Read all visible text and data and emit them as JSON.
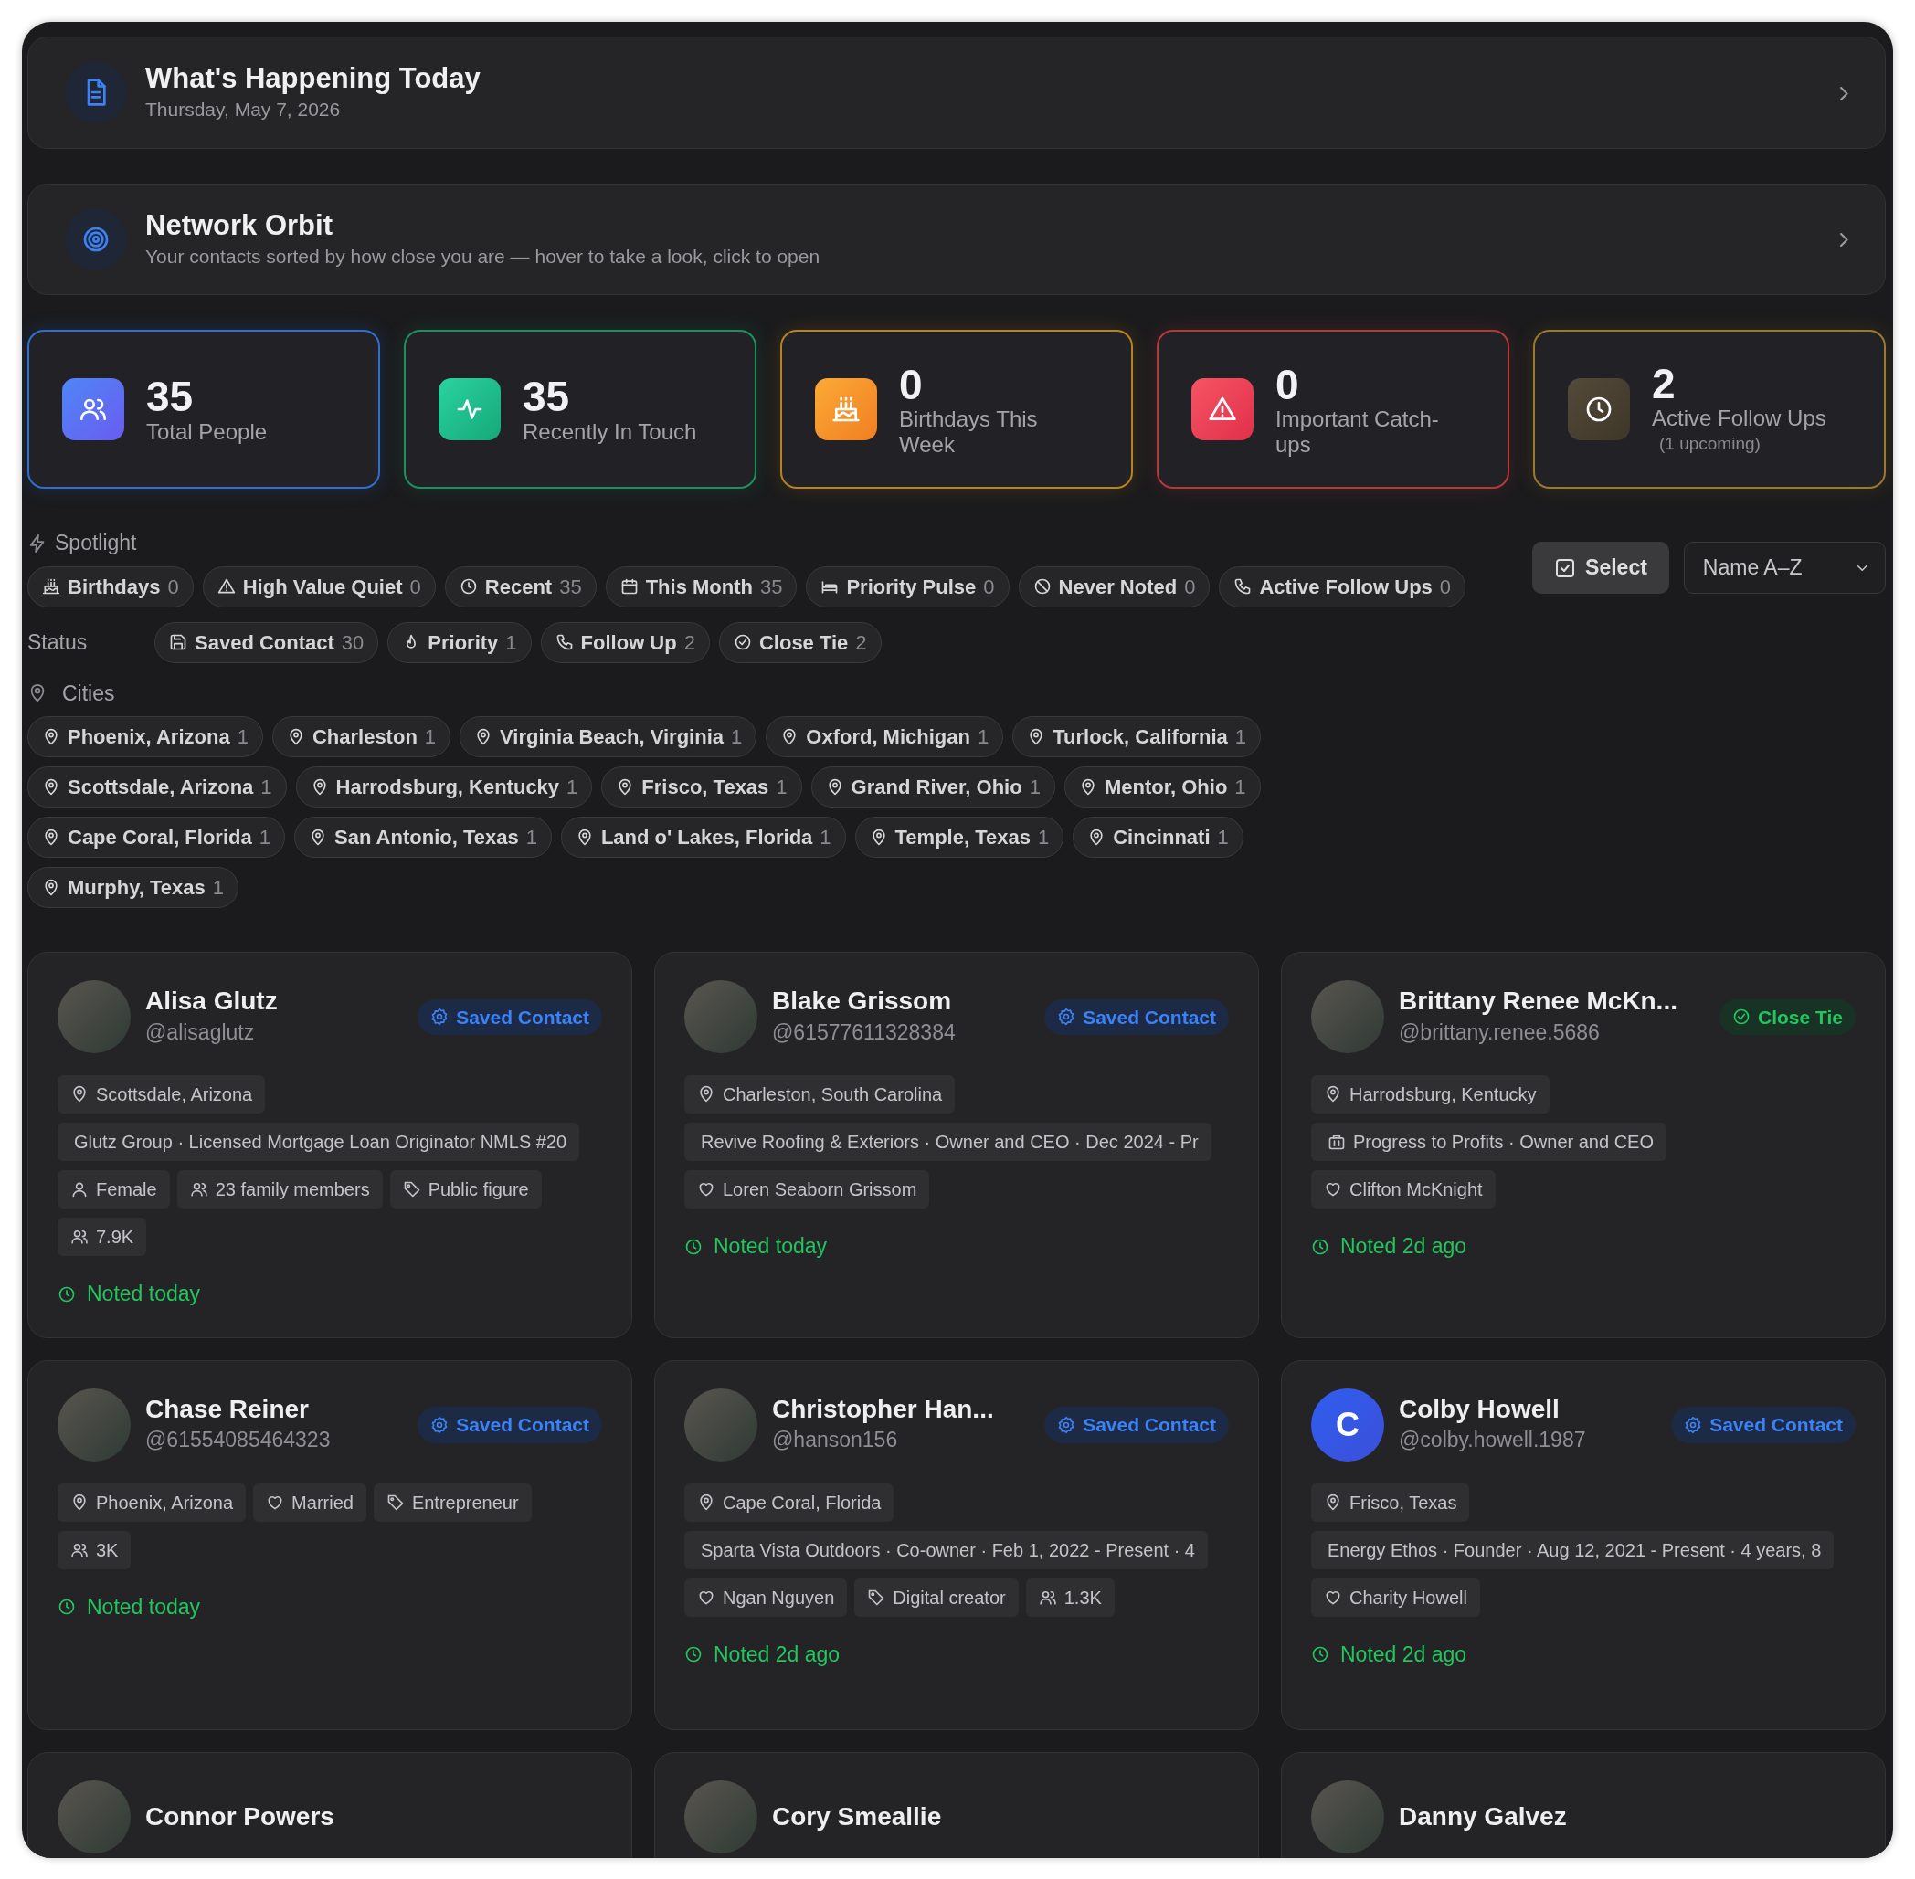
{
  "header_cards": [
    {
      "kind": "today",
      "title": "What's Happening Today",
      "subtitle": "Thursday, May 7, 2026"
    },
    {
      "kind": "orbit",
      "title": "Network Orbit",
      "subtitle": "Your contacts sorted by how close you are — hover to take a look, click to open"
    }
  ],
  "stats": [
    {
      "kind": "people",
      "value": "35",
      "label": "Total People",
      "color": "#2f6fd1"
    },
    {
      "kind": "pulse",
      "value": "35",
      "label": "Recently In Touch",
      "color": "#1f8f5f"
    },
    {
      "kind": "cake",
      "value": "0",
      "label": "Birthdays This Week",
      "color": "#b8821e"
    },
    {
      "kind": "warning",
      "value": "0",
      "label": "Important Catch-ups",
      "color": "#b33a3a"
    },
    {
      "kind": "clock",
      "value": "2",
      "label": "Active Follow Ups",
      "note": "(1 upcoming)",
      "color": "#9c7a2a"
    }
  ],
  "spotlight": {
    "label": "Spotlight",
    "chips": [
      {
        "kind": "cake",
        "label": "Birthdays",
        "count": "0"
      },
      {
        "kind": "warning",
        "label": "High Value Quiet",
        "count": "0"
      },
      {
        "kind": "clock",
        "label": "Recent",
        "count": "35"
      },
      {
        "kind": "calendar",
        "label": "This Month",
        "count": "35"
      },
      {
        "kind": "bed",
        "label": "Priority Pulse",
        "count": "0"
      },
      {
        "kind": "ban",
        "label": "Never Noted",
        "count": "0"
      },
      {
        "kind": "phone",
        "label": "Active Follow Ups",
        "count": "0"
      }
    ]
  },
  "toolbar": {
    "select_button": "Select",
    "sort": "Name A–Z"
  },
  "status": {
    "label": "Status",
    "chips": [
      {
        "kind": "save",
        "label": "Saved Contact",
        "count": "30"
      },
      {
        "kind": "flame",
        "label": "Priority",
        "count": "1"
      },
      {
        "kind": "phone",
        "label": "Follow Up",
        "count": "2"
      },
      {
        "kind": "check",
        "label": "Close Tie",
        "count": "2"
      }
    ]
  },
  "cities": {
    "label": "Cities",
    "chips": [
      {
        "label": "Phoenix, Arizona",
        "count": "1"
      },
      {
        "label": "Charleston",
        "count": "1"
      },
      {
        "label": "Virginia Beach, Virginia",
        "count": "1"
      },
      {
        "label": "Oxford, Michigan",
        "count": "1"
      },
      {
        "label": "Turlock, California",
        "count": "1"
      },
      {
        "label": "Scottsdale, Arizona",
        "count": "1"
      },
      {
        "label": "Harrodsburg, Kentucky",
        "count": "1"
      },
      {
        "label": "Frisco, Texas",
        "count": "1"
      },
      {
        "label": "Grand River, Ohio",
        "count": "1"
      },
      {
        "label": "Mentor, Ohio",
        "count": "1"
      },
      {
        "label": "Cape Coral, Florida",
        "count": "1"
      },
      {
        "label": "San Antonio, Texas",
        "count": "1"
      },
      {
        "label": "Land o' Lakes, Florida",
        "count": "1"
      },
      {
        "label": "Temple, Texas",
        "count": "1"
      },
      {
        "label": "Cincinnati",
        "count": "1"
      },
      {
        "label": "Murphy, Texas",
        "count": "1"
      }
    ]
  },
  "contacts": [
    {
      "name": "Alisa Glutz",
      "handle": "@alisaglutz",
      "badge": {
        "kind": "saved",
        "label": "Saved Contact"
      },
      "tags": [
        {
          "kind": "location",
          "text": "Scottsdale, Arizona"
        },
        {
          "kind": "work-plain",
          "text": "Glutz Group · Licensed Mortgage Loan Originator NMLS #20"
        },
        {
          "kind": "gender",
          "text": "Female"
        },
        {
          "kind": "family",
          "text": "23 family members"
        },
        {
          "kind": "category",
          "text": "Public figure"
        },
        {
          "kind": "followers",
          "text": "7.9K"
        }
      ],
      "noted": "Noted today"
    },
    {
      "name": "Blake Grissom",
      "handle": "@61577611328384",
      "badge": {
        "kind": "saved",
        "label": "Saved Contact"
      },
      "tags": [
        {
          "kind": "location",
          "text": "Charleston, South Carolina"
        },
        {
          "kind": "work-plain",
          "text": "Revive Roofing & Exteriors · Owner and CEO · Dec 2024 - Pr"
        },
        {
          "kind": "partner",
          "text": "Loren Seaborn Grissom"
        }
      ],
      "noted": "Noted today"
    },
    {
      "name": "Brittany Renee McKn...",
      "handle": "@brittany.renee.5686",
      "badge": {
        "kind": "close",
        "label": "Close Tie"
      },
      "tags": [
        {
          "kind": "location",
          "text": "Harrodsburg, Kentucky"
        },
        {
          "kind": "work",
          "text": "Progress to Profits · Owner and CEO"
        },
        {
          "kind": "partner",
          "text": "Clifton McKnight"
        }
      ],
      "noted": "Noted 2d ago"
    },
    {
      "name": "Chase Reiner",
      "handle": "@61554085464323",
      "badge": {
        "kind": "saved",
        "label": "Saved Contact"
      },
      "tags": [
        {
          "kind": "location",
          "text": "Phoenix, Arizona"
        },
        {
          "kind": "partner",
          "text": "Married"
        },
        {
          "kind": "category",
          "text": "Entrepreneur"
        },
        {
          "kind": "followers",
          "text": "3K"
        }
      ],
      "noted": "Noted today"
    },
    {
      "name": "Christopher Han...",
      "handle": "@hanson156",
      "badge": {
        "kind": "saved",
        "label": "Saved Contact"
      },
      "tags": [
        {
          "kind": "location",
          "text": "Cape Coral, Florida"
        },
        {
          "kind": "work-plain",
          "text": "Sparta Vista Outdoors · Co-owner · Feb 1, 2022 - Present · 4"
        },
        {
          "kind": "partner",
          "text": "Ngan Nguyen"
        },
        {
          "kind": "category",
          "text": "Digital creator"
        },
        {
          "kind": "followers",
          "text": "1.3K"
        }
      ],
      "noted": "Noted 2d ago"
    },
    {
      "name": "Colby Howell",
      "handle": "@colby.howell.1987",
      "avatar_letter": "C",
      "badge": {
        "kind": "saved",
        "label": "Saved Contact"
      },
      "tags": [
        {
          "kind": "location",
          "text": "Frisco, Texas"
        },
        {
          "kind": "work-plain",
          "text": "Energy Ethos · Founder · Aug 12, 2021 - Present · 4 years, 8"
        },
        {
          "kind": "partner",
          "text": "Charity Howell"
        }
      ],
      "noted": "Noted 2d ago"
    },
    {
      "name": "Connor Powers"
    },
    {
      "name": "Cory Smeallie"
    },
    {
      "name": "Danny Galvez"
    }
  ]
}
